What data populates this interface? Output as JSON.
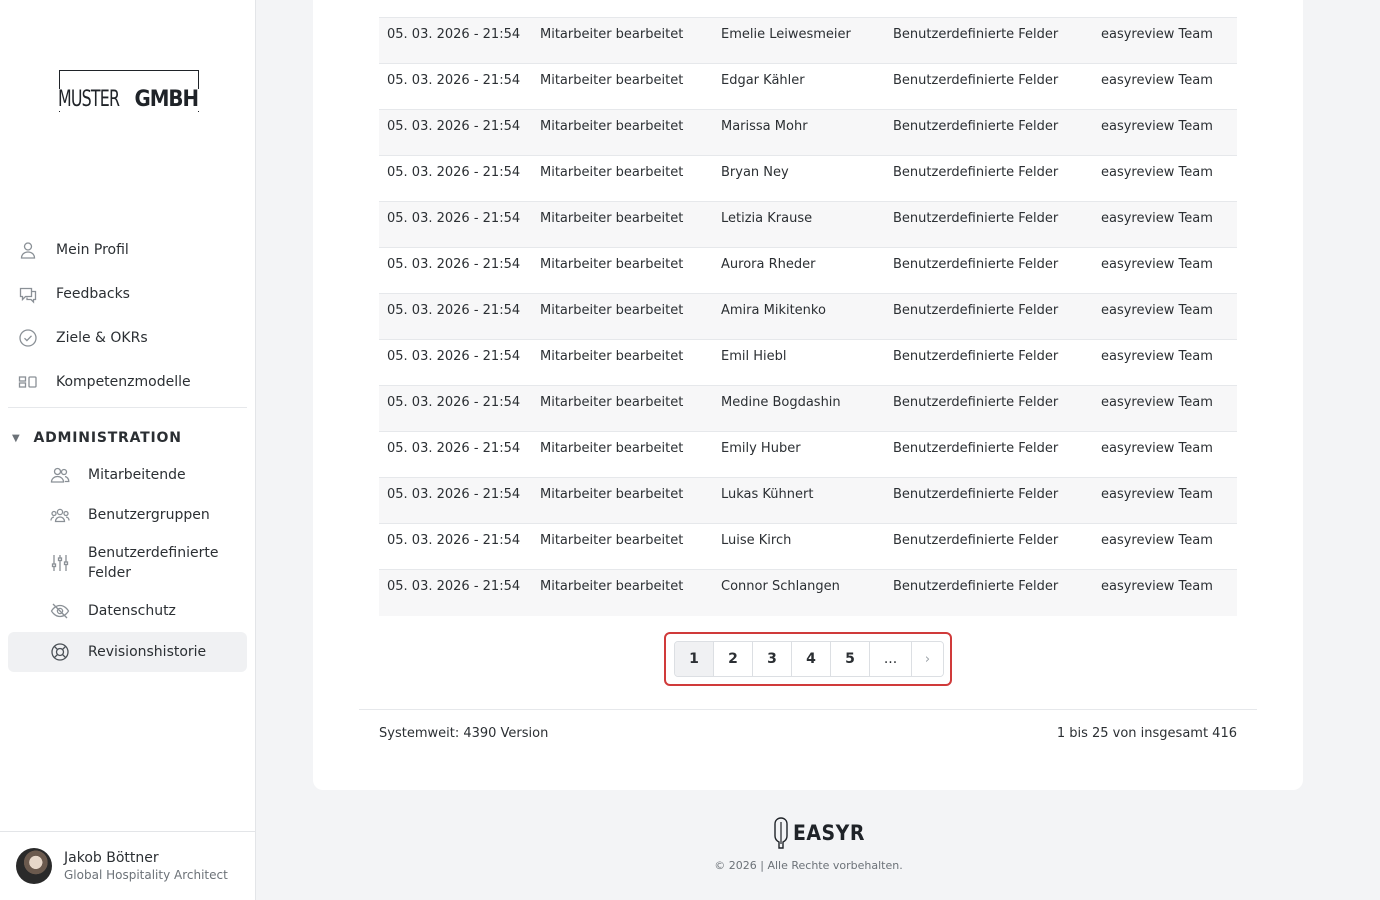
{
  "logo": {
    "part1": "MUSTER",
    "part2": "GMBH"
  },
  "sidebar": {
    "items": [
      {
        "label": "Mein Profil",
        "icon": "user-icon"
      },
      {
        "label": "Feedbacks",
        "icon": "chat-icon"
      },
      {
        "label": "Ziele & OKRs",
        "icon": "check-circle-icon"
      },
      {
        "label": "Kompetenzmodelle",
        "icon": "model-icon"
      }
    ],
    "admin_label": "ADMINISTRATION",
    "admin_items": [
      {
        "label": "Mitarbeitende",
        "icon": "users-icon"
      },
      {
        "label": "Benutzergruppen",
        "icon": "groups-icon"
      },
      {
        "label": "Benutzerdefinierte Felder",
        "icon": "sliders-icon"
      },
      {
        "label": "Datenschutz",
        "icon": "eye-off-icon"
      },
      {
        "label": "Revisionshistorie",
        "icon": "lifebuoy-icon"
      }
    ]
  },
  "user": {
    "name": "Jakob Böttner",
    "role": "Global Hospitality Architect"
  },
  "table": {
    "rows": [
      [
        "05. 03. 2026 - 21:54",
        "Mitarbeiter bearbeitet",
        "Emelie Leiwesmeier",
        "Benutzerdefinierte Felder",
        "easyreview Team"
      ],
      [
        "05. 03. 2026 - 21:54",
        "Mitarbeiter bearbeitet",
        "Edgar Kähler",
        "Benutzerdefinierte Felder",
        "easyreview Team"
      ],
      [
        "05. 03. 2026 - 21:54",
        "Mitarbeiter bearbeitet",
        "Marissa Mohr",
        "Benutzerdefinierte Felder",
        "easyreview Team"
      ],
      [
        "05. 03. 2026 - 21:54",
        "Mitarbeiter bearbeitet",
        "Bryan Ney",
        "Benutzerdefinierte Felder",
        "easyreview Team"
      ],
      [
        "05. 03. 2026 - 21:54",
        "Mitarbeiter bearbeitet",
        "Letizia Krause",
        "Benutzerdefinierte Felder",
        "easyreview Team"
      ],
      [
        "05. 03. 2026 - 21:54",
        "Mitarbeiter bearbeitet",
        "Aurora Rheder",
        "Benutzerdefinierte Felder",
        "easyreview Team"
      ],
      [
        "05. 03. 2026 - 21:54",
        "Mitarbeiter bearbeitet",
        "Amira Mikitenko",
        "Benutzerdefinierte Felder",
        "easyreview Team"
      ],
      [
        "05. 03. 2026 - 21:54",
        "Mitarbeiter bearbeitet",
        "Emil Hiebl",
        "Benutzerdefinierte Felder",
        "easyreview Team"
      ],
      [
        "05. 03. 2026 - 21:54",
        "Mitarbeiter bearbeitet",
        "Medine Bogdashin",
        "Benutzerdefinierte Felder",
        "easyreview Team"
      ],
      [
        "05. 03. 2026 - 21:54",
        "Mitarbeiter bearbeitet",
        "Emily Huber",
        "Benutzerdefinierte Felder",
        "easyreview Team"
      ],
      [
        "05. 03. 2026 - 21:54",
        "Mitarbeiter bearbeitet",
        "Lukas Kühnert",
        "Benutzerdefinierte Felder",
        "easyreview Team"
      ],
      [
        "05. 03. 2026 - 21:54",
        "Mitarbeiter bearbeitet",
        "Luise Kirch",
        "Benutzerdefinierte Felder",
        "easyreview Team"
      ],
      [
        "05. 03. 2026 - 21:54",
        "Mitarbeiter bearbeitet",
        "Connor Schlangen",
        "Benutzerdefinierte Felder",
        "easyreview Team"
      ]
    ]
  },
  "pagination": {
    "pages": [
      "1",
      "2",
      "3",
      "4",
      "5"
    ],
    "ellipsis": "...",
    "next": "›",
    "current": "1",
    "highlight_color": "#d03a3a"
  },
  "summary": {
    "left": "Systemweit: 4390 Version",
    "right": "1 bis 25 von insgesamt 416"
  },
  "footer": {
    "brand": "EASYR",
    "copyright": "© 2026 | Alle Rechte vorbehalten."
  }
}
